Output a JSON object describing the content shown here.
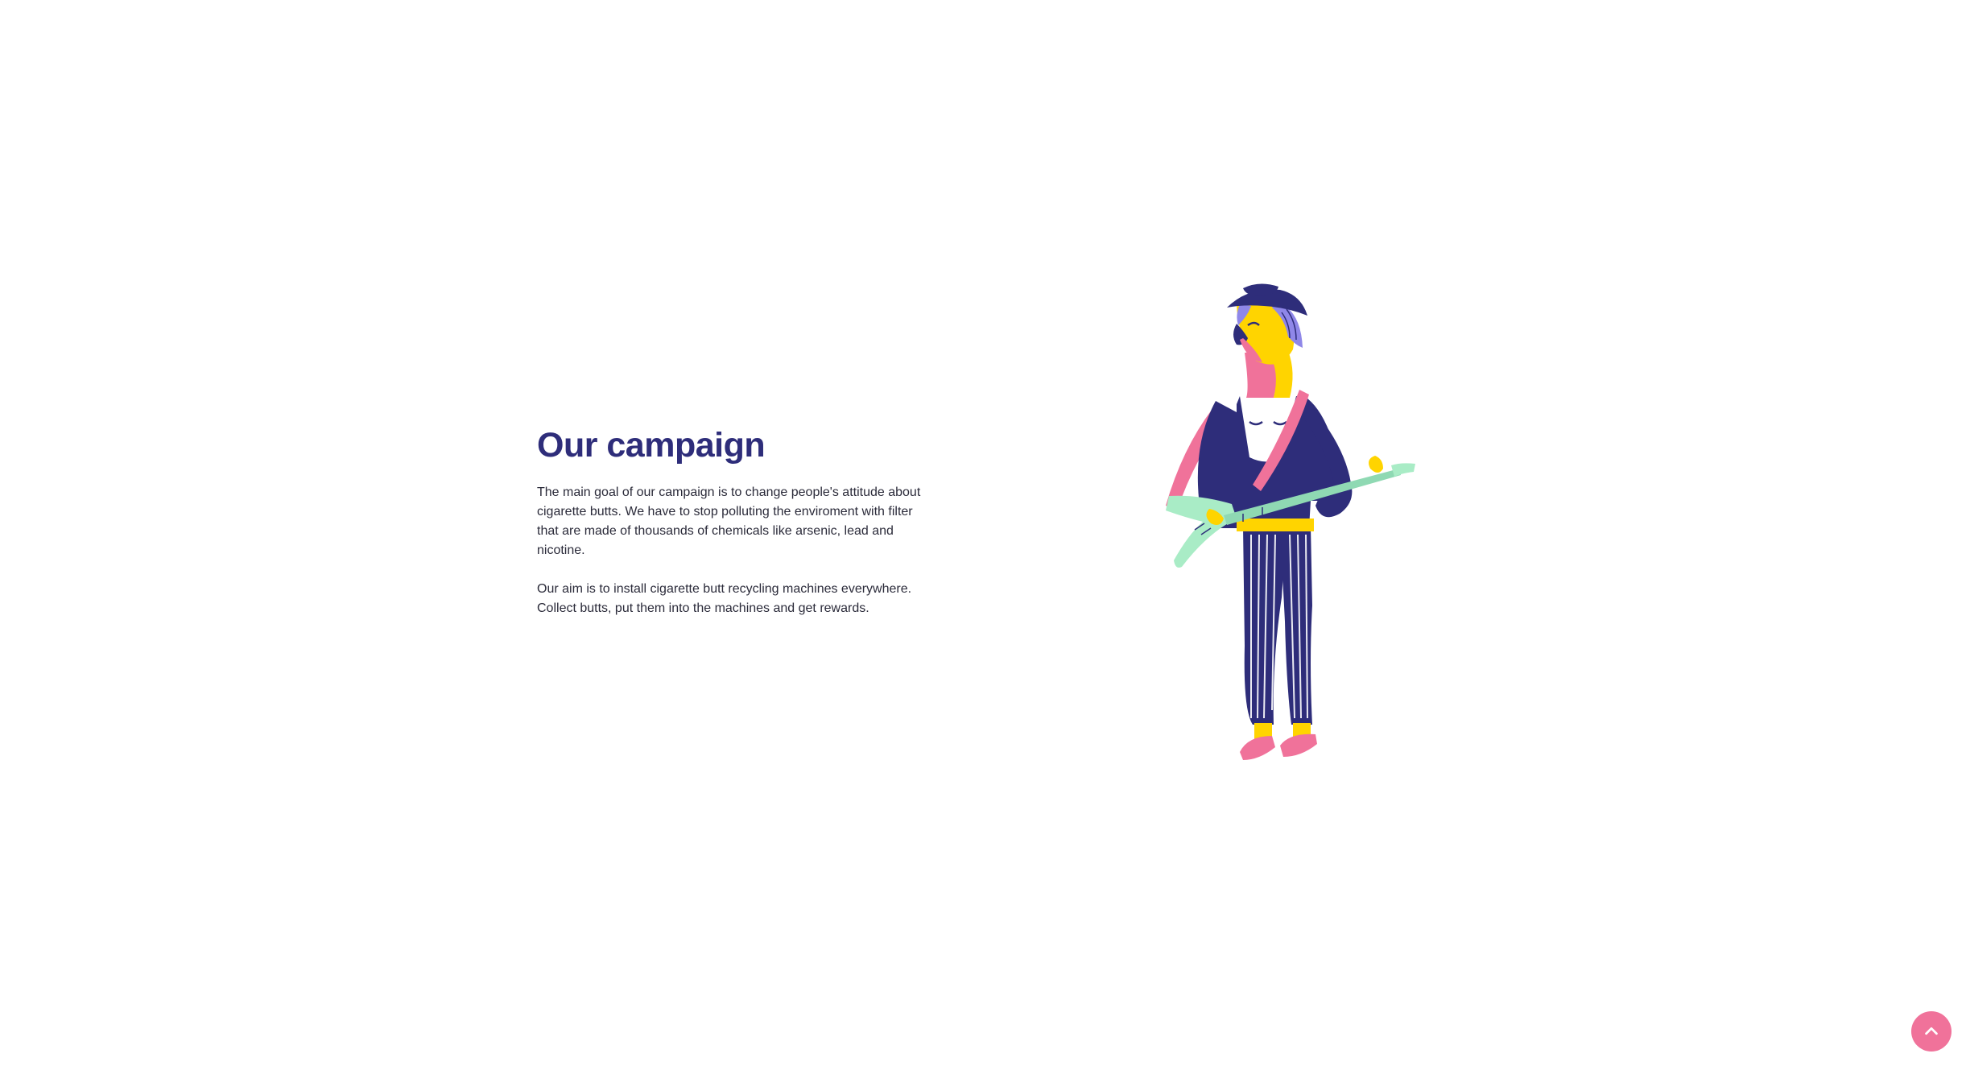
{
  "campaign": {
    "title": "Our campaign",
    "paragraphs": [
      "The main goal of our campaign is to change people's attitude about cigarette butts. We have to stop polluting the enviroment with filter that are made of thousands of chemicals like arsenic, lead and nicotine.",
      "Our aim is to install cigarette butt recycling machines everywhere. Collect butts, put them into the machines and get rewards."
    ]
  },
  "illustration": {
    "icon": "guitar-player-illustration"
  },
  "scroll_top": {
    "icon": "chevron-up-icon"
  },
  "colors": {
    "title": "#2e2d7a",
    "body_text": "#2b2b3a",
    "accent_pink": "#f0729a",
    "navy": "#2e2d7a",
    "yellow": "#ffd400",
    "lavender": "#8f87e8",
    "mint": "#a9ecc6"
  }
}
